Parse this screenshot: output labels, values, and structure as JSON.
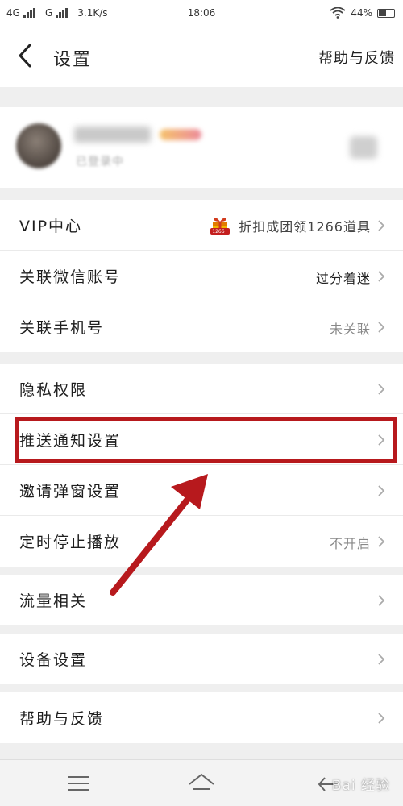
{
  "status": {
    "net1": "4G",
    "net2": "G",
    "speed": "3.1K/s",
    "time": "18:06",
    "battery": "44%"
  },
  "nav": {
    "title": "设置",
    "help": "帮助与反馈"
  },
  "profile": {
    "login_status": "已登录中"
  },
  "groups": [
    {
      "rows": [
        {
          "label": "VIP中心",
          "value": "折扣成团领1266道具"
        },
        {
          "label": "关联微信账号",
          "value": "过分着迷"
        },
        {
          "label": "关联手机号",
          "value": "未关联"
        }
      ]
    },
    {
      "rows": [
        {
          "label": "隐私权限",
          "value": ""
        },
        {
          "label": "推送通知设置",
          "value": ""
        },
        {
          "label": "邀请弹窗设置",
          "value": ""
        },
        {
          "label": "定时停止播放",
          "value": "不开启"
        }
      ]
    },
    {
      "rows": [
        {
          "label": "流量相关",
          "value": ""
        }
      ]
    },
    {
      "rows": [
        {
          "label": "设备设置",
          "value": ""
        }
      ]
    },
    {
      "rows": [
        {
          "label": "帮助与反馈",
          "value": ""
        }
      ]
    }
  ],
  "vip_badge_text": "1266",
  "watermark": "Bai 经验",
  "colors": {
    "highlight": "#b7191d",
    "background": "#efefef"
  }
}
